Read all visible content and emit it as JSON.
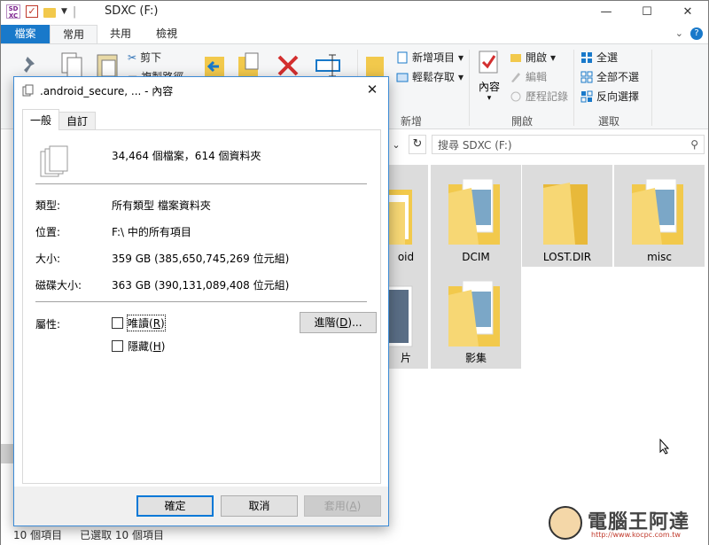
{
  "explorer": {
    "window_title": "SDXC (F:)",
    "drive_label": "SD XC",
    "ribbon_tabs": [
      "檔案",
      "常用",
      "共用",
      "檢視"
    ],
    "ribbon": {
      "cut": "剪下",
      "copy_path": "複製路徑",
      "new_item": "新增項目",
      "easy_access": "輕鬆存取",
      "new_group": "新增",
      "properties": "內容",
      "open": "開啟",
      "edit": "編輯",
      "history": "歷程記錄",
      "open_group": "開啟",
      "select_all": "全選",
      "select_none": "全部不選",
      "invert_selection": "反向選擇",
      "select_group": "選取"
    },
    "search_placeholder": "搜尋 SDXC (F:)",
    "tiles": [
      {
        "label": "oid"
      },
      {
        "label": "DCIM"
      },
      {
        "label": "LOST.DIR"
      },
      {
        "label": "misc"
      },
      {
        "label": "片"
      },
      {
        "label": "影集"
      }
    ],
    "status": {
      "item_count": "10 個項目",
      "selected": "已選取 10 個項目"
    },
    "watermark": "電腦王阿達",
    "watermark_url": "http://www.kocpc.com.tw"
  },
  "dialog": {
    "title": ".android_secure, ... - 內容",
    "tabs": [
      "一般",
      "自訂"
    ],
    "summary": "34,464 個檔案，614 個資料夾",
    "type_label": "類型:",
    "type_value": "所有類型 檔案資料夾",
    "location_label": "位置:",
    "location_value": "F:\\ 中的所有項目",
    "size_label": "大小:",
    "size_value": "359 GB (385,650,745,269 位元組)",
    "disk_size_label": "磁碟大小:",
    "disk_size_value": "363 GB (390,131,089,408 位元組)",
    "attributes_label": "屬性:",
    "readonly_text": "唯讀(",
    "readonly_key": "R",
    "hidden_text": "隱藏(",
    "hidden_key": "H",
    "advanced_text": "進階(",
    "advanced_key": "D",
    "advanced_suffix": ")...",
    "ok": "確定",
    "cancel": "取消",
    "apply_text": "套用(",
    "apply_key": "A",
    "close_paren": ")"
  }
}
